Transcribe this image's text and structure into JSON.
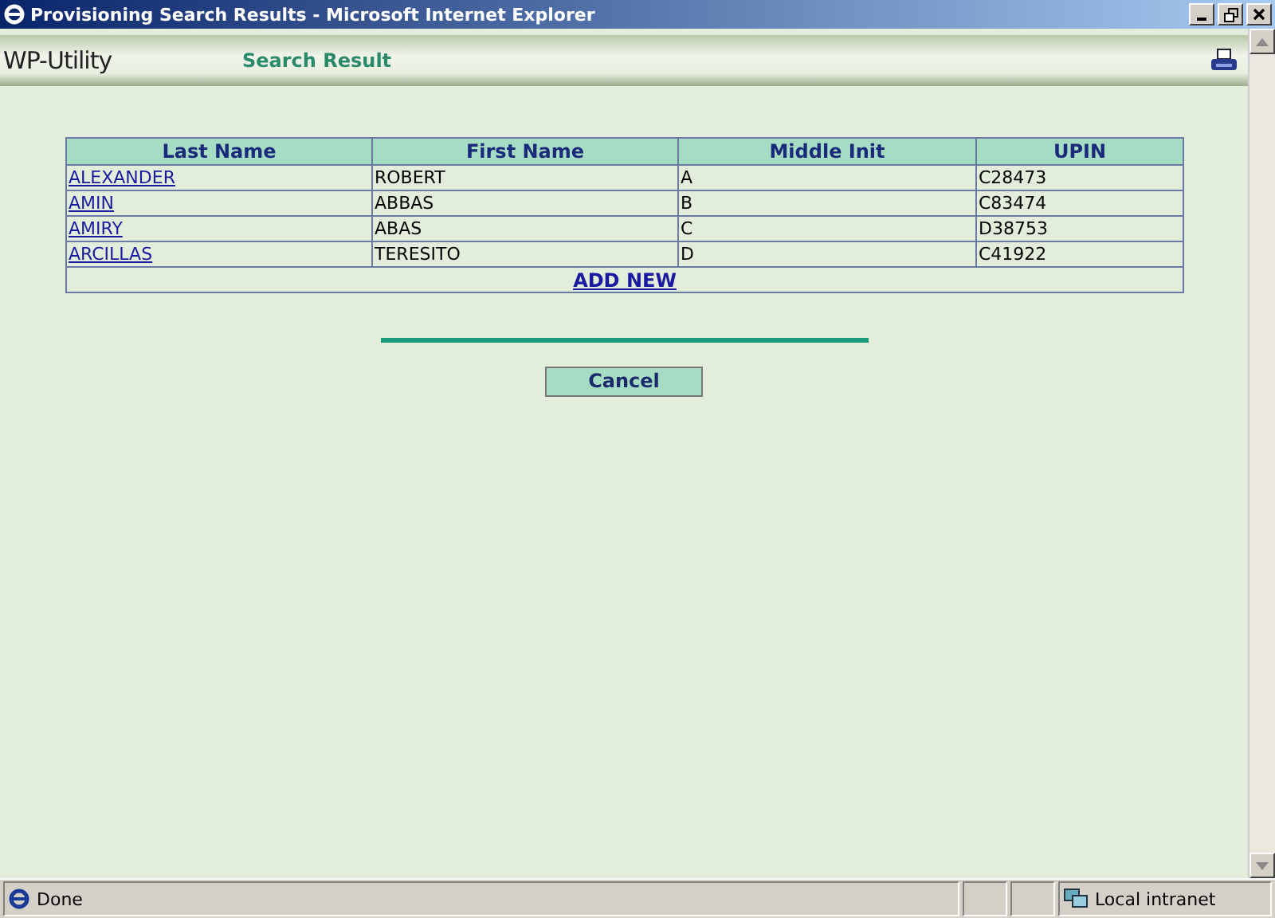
{
  "window": {
    "title": "Provisioning Search Results - Microsoft Internet Explorer"
  },
  "header": {
    "app_name": "WP-Utility",
    "page_title": "Search Result"
  },
  "table": {
    "columns": [
      "Last Name",
      "First Name",
      "Middle Init",
      "UPIN"
    ],
    "rows": [
      {
        "last_name": "ALEXANDER",
        "first_name": "ROBERT",
        "middle_init": "A",
        "upin": "C28473"
      },
      {
        "last_name": "AMIN",
        "first_name": "ABBAS",
        "middle_init": "B",
        "upin": "C83474"
      },
      {
        "last_name": "AMIRY",
        "first_name": "ABAS",
        "middle_init": "C",
        "upin": "D38753"
      },
      {
        "last_name": "ARCILLAS",
        "first_name": "TERESITO",
        "middle_init": "D",
        "upin": "C41922"
      }
    ],
    "add_link": "ADD NEW"
  },
  "buttons": [
    "Cancel"
  ],
  "status_bar": {
    "status": "Done",
    "zone": "Local intranet"
  }
}
